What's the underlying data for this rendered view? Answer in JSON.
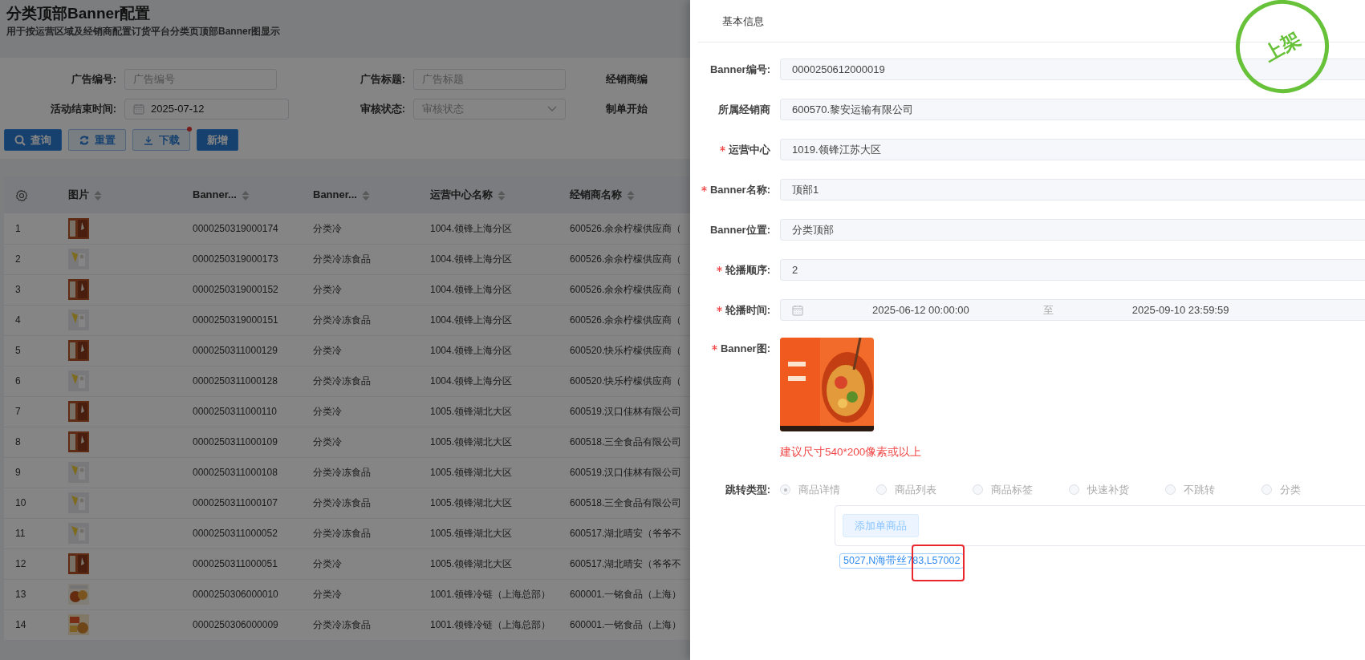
{
  "page": {
    "title": "分类顶部Banner配置",
    "subtitle": "用于按运营区域及经销商配置订货平台分类页顶部Banner图显示"
  },
  "filters": [
    {
      "kind": "text",
      "label": "广告编号:",
      "placeholder": "广告编号"
    },
    {
      "kind": "text",
      "label": "广告标题:",
      "placeholder": "广告标题"
    },
    {
      "kind": "cut",
      "label": "经销商编"
    },
    {
      "kind": "date",
      "label": "活动结束时间:",
      "value": "2025-07-12"
    },
    {
      "kind": "select",
      "label": "审核状态:",
      "placeholder": "审核状态"
    },
    {
      "kind": "cut",
      "label": "制单开始"
    }
  ],
  "buttons": [
    {
      "kind": "search",
      "label": "查询",
      "dot": false
    },
    {
      "kind": "reset",
      "label": "重置",
      "dot": false
    },
    {
      "kind": "download",
      "label": "下载",
      "dot": true
    },
    {
      "kind": "add",
      "label": "新增",
      "dot": false
    }
  ],
  "table": {
    "columns": [
      {
        "kind": "settings"
      },
      {
        "kind": "text",
        "label": "图片",
        "sortable": true
      },
      {
        "kind": "text",
        "label": "Banner...",
        "sortable": true
      },
      {
        "kind": "text",
        "label": "Banner...",
        "sortable": true
      },
      {
        "kind": "text",
        "label": "运营中心名称",
        "sortable": true
      },
      {
        "kind": "text",
        "label": "经销商名称",
        "sortable": true
      }
    ],
    "rows": [
      {
        "index": "1",
        "code": "0000250319000174",
        "name": "分类冷",
        "center": "1004.领锋上海分区",
        "dealer": "600526.余余柠檬供应商（"
      },
      {
        "index": "2",
        "code": "0000250319000173",
        "name": "分类冷冻食品",
        "center": "1004.领锋上海分区",
        "dealer": "600526.余余柠檬供应商（"
      },
      {
        "index": "3",
        "code": "0000250319000152",
        "name": "分类冷",
        "center": "1004.领锋上海分区",
        "dealer": "600526.余余柠檬供应商（"
      },
      {
        "index": "4",
        "code": "0000250319000151",
        "name": "分类冷冻食品",
        "center": "1004.领锋上海分区",
        "dealer": "600526.余余柠檬供应商（"
      },
      {
        "index": "5",
        "code": "0000250311000129",
        "name": "分类冷",
        "center": "1004.领锋上海分区",
        "dealer": "600520.快乐柠檬供应商（"
      },
      {
        "index": "6",
        "code": "0000250311000128",
        "name": "分类冷冻食品",
        "center": "1004.领锋上海分区",
        "dealer": "600520.快乐柠檬供应商（"
      },
      {
        "index": "7",
        "code": "0000250311000110",
        "name": "分类冷",
        "center": "1005.领锋湖北大区",
        "dealer": "600519.汉口佳林有限公司"
      },
      {
        "index": "8",
        "code": "0000250311000109",
        "name": "分类冷",
        "center": "1005.领锋湖北大区",
        "dealer": "600518.三全食品有限公司"
      },
      {
        "index": "9",
        "code": "0000250311000108",
        "name": "分类冷冻食品",
        "center": "1005.领锋湖北大区",
        "dealer": "600519.汉口佳林有限公司"
      },
      {
        "index": "10",
        "code": "0000250311000107",
        "name": "分类冷冻食品",
        "center": "1005.领锋湖北大区",
        "dealer": "600518.三全食品有限公司"
      },
      {
        "index": "11",
        "code": "0000250311000052",
        "name": "分类冷冻食品",
        "center": "1005.领锋湖北大区",
        "dealer": "600517.湖北晴安（爷爷不"
      },
      {
        "index": "12",
        "code": "0000250311000051",
        "name": "分类冷",
        "center": "1005.领锋湖北大区",
        "dealer": "600517.湖北晴安（爷爷不"
      },
      {
        "index": "13",
        "code": "0000250306000010",
        "name": "分类冷",
        "center": "1001.领锋冷链（上海总部）",
        "dealer": "600001.一铭食品（上海）"
      },
      {
        "index": "14",
        "code": "0000250306000009",
        "name": "分类冷冻食品",
        "center": "1001.领锋冷链（上海总部）",
        "dealer": "600001.一铭食品（上海）"
      }
    ]
  },
  "drawer": {
    "section_title": "基本信息",
    "stamp": "上架",
    "fields": [
      {
        "kind": "text",
        "label": "Banner编号:",
        "required": false,
        "value": "0000250612000019"
      },
      {
        "kind": "text",
        "label": "所属经销商",
        "required": false,
        "value": "600570.黎安运输有限公司"
      },
      {
        "kind": "text",
        "label": "运营中心",
        "required": true,
        "value": "1019.领锋江苏大区"
      },
      {
        "kind": "text",
        "label": "Banner名称:",
        "required": true,
        "value": "顶部1"
      },
      {
        "kind": "text",
        "label": "Banner位置:",
        "required": false,
        "value": "分类顶部"
      },
      {
        "kind": "text",
        "label": "轮播顺序:",
        "required": true,
        "value": "2"
      },
      {
        "kind": "daterange",
        "label": "轮播时间:",
        "required": true,
        "start": "2025-06-12 00:00:00",
        "separator": "至",
        "end": "2025-09-10 23:59:59"
      }
    ],
    "banner_image": {
      "label": "Banner图:",
      "required": true,
      "hint": "建议尺寸540*200像素或以上"
    },
    "jump": {
      "label": "跳转类型:",
      "options": [
        {
          "label": "商品详情",
          "selected": true,
          "disabled": true
        },
        {
          "label": "商品列表",
          "selected": false,
          "disabled": true
        },
        {
          "label": "商品标签",
          "selected": false,
          "disabled": true
        },
        {
          "label": "快速补货",
          "selected": false,
          "disabled": true
        },
        {
          "label": "不跳转",
          "selected": false,
          "disabled": true
        },
        {
          "label": "分类",
          "selected": false,
          "disabled": true
        }
      ],
      "add_button": "添加单商品",
      "tags": [
        "5027,N海带丝783,L57002"
      ],
      "highlight_box": true
    }
  }
}
